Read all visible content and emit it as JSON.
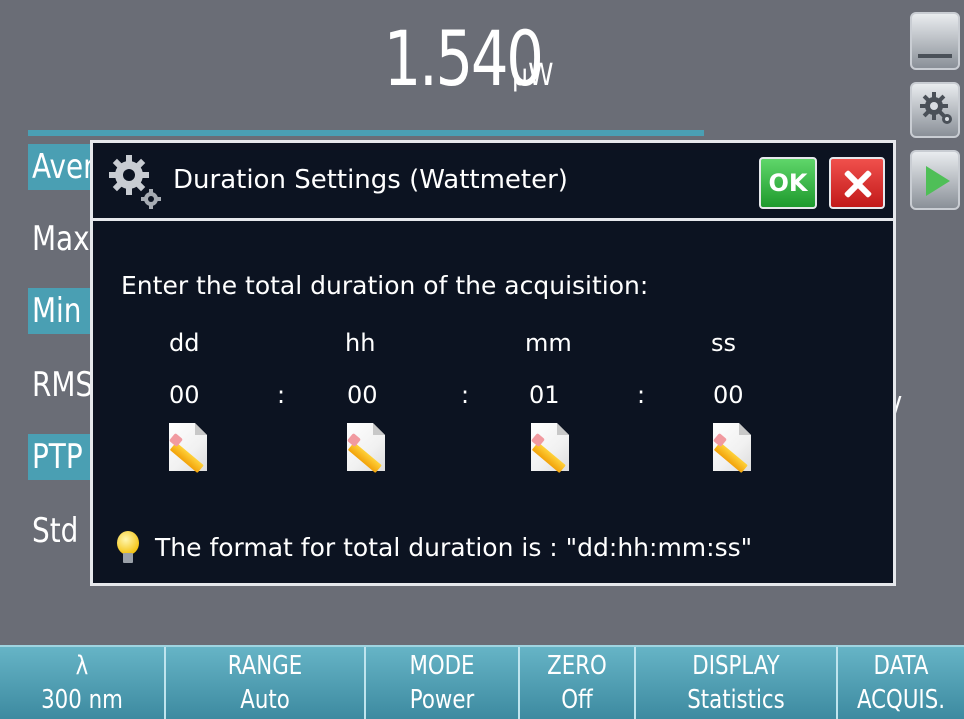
{
  "reading": {
    "value": "1.540",
    "unit": "μW"
  },
  "stats": [
    {
      "label": "Average",
      "highlight": true
    },
    {
      "label": "Max",
      "highlight": false
    },
    {
      "label": "Min",
      "highlight": true
    },
    {
      "label": "RMS",
      "highlight": false
    },
    {
      "label": "PTP",
      "highlight": true
    },
    {
      "label": "Std",
      "highlight": false
    }
  ],
  "side_buttons": [
    "minimize-icon",
    "settings-icon",
    "play-icon"
  ],
  "bottom_bar": [
    {
      "top": "λ",
      "bottom": "300 nm"
    },
    {
      "top": "RANGE",
      "bottom": "Auto"
    },
    {
      "top": "MODE",
      "bottom": "Power"
    },
    {
      "top": "ZERO",
      "bottom": "Off"
    },
    {
      "top": "DISPLAY",
      "bottom": "Statistics"
    },
    {
      "top": "DATA",
      "bottom": "ACQUIS."
    }
  ],
  "dialog": {
    "title": "Duration Settings  (Wattmeter)",
    "ok_label": "OK",
    "prompt": "Enter the total duration of the acquisition:",
    "fields": [
      {
        "label": "dd",
        "value": "00"
      },
      {
        "label": "hh",
        "value": "00"
      },
      {
        "label": "mm",
        "value": "01"
      },
      {
        "label": "ss",
        "value": "00"
      }
    ],
    "separator": ":",
    "hint": "The format for total duration is : \"dd:hh:mm:ss\""
  }
}
